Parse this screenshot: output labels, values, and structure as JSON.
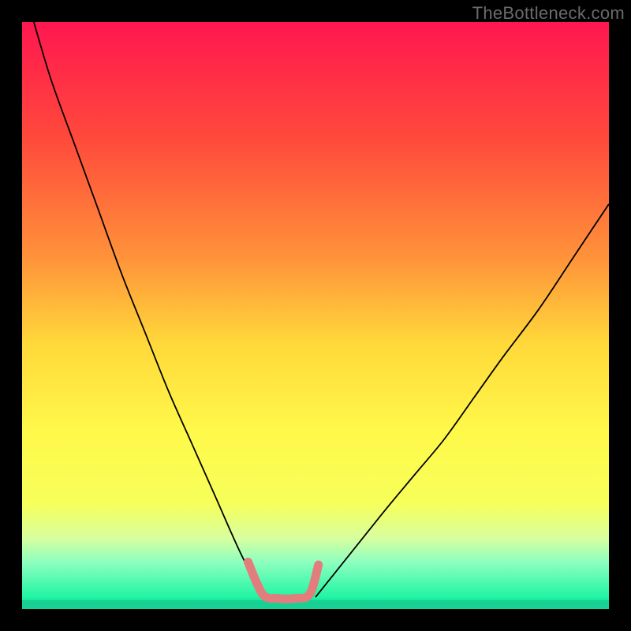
{
  "watermark": "TheBottleneck.com",
  "chart_data": {
    "type": "line",
    "title": "",
    "xlabel": "",
    "ylabel": "",
    "xlim": [
      0,
      100
    ],
    "ylim": [
      0,
      100
    ],
    "background_gradient": {
      "direction": "vertical",
      "stops": [
        {
          "pos": 0.0,
          "color": "#ff1750"
        },
        {
          "pos": 0.2,
          "color": "#ff4a3b"
        },
        {
          "pos": 0.4,
          "color": "#ff923a"
        },
        {
          "pos": 0.55,
          "color": "#ffd93a"
        },
        {
          "pos": 0.7,
          "color": "#fff94a"
        },
        {
          "pos": 0.82,
          "color": "#f7ff5a"
        },
        {
          "pos": 0.88,
          "color": "#d7ffa0"
        },
        {
          "pos": 0.92,
          "color": "#8effbf"
        },
        {
          "pos": 0.98,
          "color": "#20f5a3"
        },
        {
          "pos": 1.0,
          "color": "#12c188"
        }
      ]
    },
    "series": [
      {
        "name": "left-branch",
        "color": "#000000",
        "stroke_width": 1.8,
        "x": [
          2,
          5,
          9,
          13,
          17,
          21,
          25,
          29,
          33,
          37,
          41
        ],
        "y": [
          100,
          90,
          79,
          68,
          57,
          47,
          37,
          28,
          19,
          10,
          2
        ]
      },
      {
        "name": "right-branch",
        "color": "#000000",
        "stroke_width": 1.8,
        "x": [
          50,
          54,
          58,
          62,
          67,
          72,
          77,
          82,
          88,
          94,
          100
        ],
        "y": [
          2,
          7,
          12,
          17,
          23,
          29,
          36,
          43,
          51,
          60,
          69
        ]
      },
      {
        "name": "overlay-marker",
        "color": "#e27d7d",
        "stroke_width": 11,
        "linecap": "round",
        "x": [
          38.5,
          41.0,
          43.5,
          46.5,
          49.0,
          50.5
        ],
        "y": [
          8.0,
          2.5,
          1.8,
          1.8,
          2.5,
          7.5
        ]
      }
    ],
    "bottom_band": {
      "from_y": 0,
      "to_y": 1.5,
      "color": "#17d094"
    }
  },
  "colors": {
    "frame": "#000000",
    "watermark": "#6a6a6a"
  }
}
